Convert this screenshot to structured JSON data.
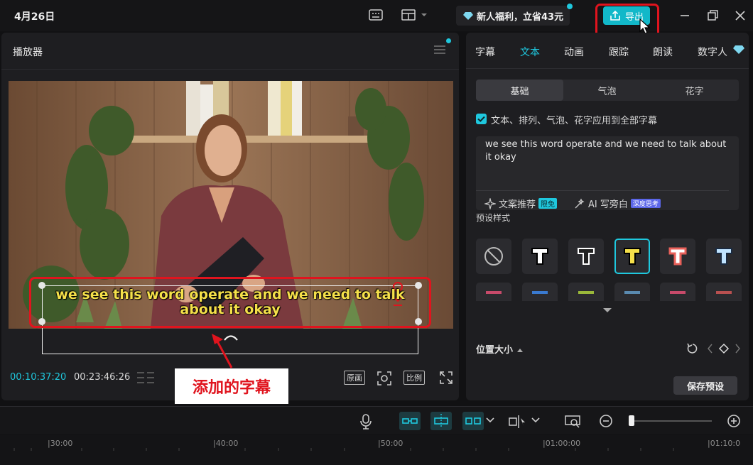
{
  "topbar": {
    "date": "4月26日",
    "promo": "新人福利，立省43元",
    "export_label": "导出"
  },
  "player": {
    "title": "播放器",
    "current_time": "00:10:37:20",
    "total_time": "00:23:46:26",
    "btn_original": "原画",
    "btn_ratio": "比例"
  },
  "subtitle_overlay": "we see this word operate and we need to talk about it okay",
  "callout": "添加的字幕",
  "side": {
    "tabs": [
      "字幕",
      "文本",
      "动画",
      "跟踪",
      "朗读",
      "数字人"
    ],
    "active_tab": "文本",
    "segments": [
      "基础",
      "气泡",
      "花字"
    ],
    "checkbox_label": "文本、排列、气泡、花字应用到全部字幕",
    "text_value": "we see this word operate and we need to talk about it okay",
    "ai_recommend": "文案推荐",
    "badge_free": "限免",
    "ai_write": "AI 写旁白",
    "badge_deep": "深度思考",
    "preset_label": "预设样式",
    "position_size": "位置大小",
    "save_preset": "保存预设"
  },
  "timeline": {
    "ticks": [
      "|30:00",
      "|40:00",
      "|50:00",
      "|01:00:00",
      "|01:10:0"
    ]
  },
  "colors": {
    "accent": "#1fc8de",
    "highlight_red": "#e0141e",
    "subtitle_yellow": "#f5e04a"
  }
}
